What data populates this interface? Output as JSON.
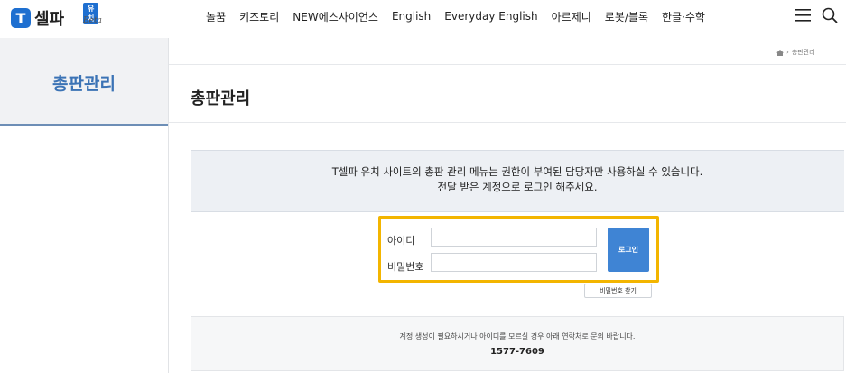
{
  "brand": {
    "mark": "T",
    "name": "셀파",
    "badge": "유치",
    "subtitle": "Beta"
  },
  "nav": {
    "items": [
      "놀꿈",
      "키즈토리",
      "NEW에스사이언스",
      "English",
      "Everyday English",
      "아르제니",
      "로봇/블록",
      "한글·수학"
    ]
  },
  "breadcrumb": {
    "current": "총판관리"
  },
  "sidebar": {
    "title": "총판관리"
  },
  "page": {
    "title": "총판관리"
  },
  "notice": {
    "line1": "T셀파 유치 사이트의 총판 관리 메뉴는 권한이 부여된 담당자만 사용하실 수 있습니다.",
    "line2": "전달 받은 계정으로 로그인 해주세요."
  },
  "login": {
    "id_label": "아이디",
    "pw_label": "비밀번호",
    "id_value": "",
    "pw_value": "",
    "button": "로그인",
    "find_password": "비밀번호 찾기"
  },
  "contact": {
    "message": "계정 생성이 필요하시거나 아이디를 모르실 경우 아래 연락처로 문의 바랍니다.",
    "phone": "1577-7609"
  },
  "colors": {
    "brand_blue": "#1e6fd0",
    "highlight": "#f3b500",
    "sidebar_title": "#3b73b5"
  }
}
